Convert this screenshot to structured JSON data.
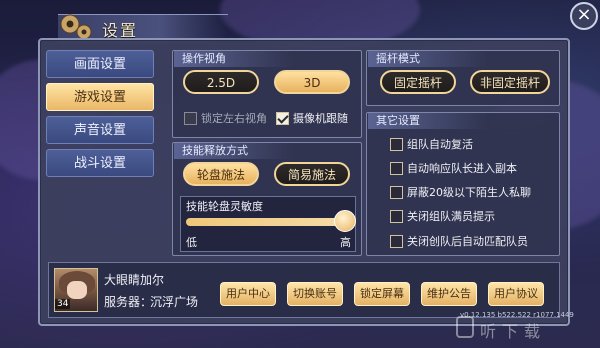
{
  "header": {
    "title": "设置",
    "close": "×"
  },
  "nav": {
    "items": [
      {
        "label": "画面设置",
        "active": false
      },
      {
        "label": "游戏设置",
        "active": true
      },
      {
        "label": "声音设置",
        "active": false
      },
      {
        "label": "战斗设置",
        "active": false
      }
    ]
  },
  "view": {
    "title": "操作视角",
    "options": [
      "2.5D",
      "3D"
    ],
    "selected": "3D",
    "lock_label": "锁定左右视角",
    "lock_checked": false,
    "follow_label": "摄像机跟随",
    "follow_checked": true
  },
  "joystick": {
    "title": "摇杆模式",
    "options": [
      "固定摇杆",
      "非固定摇杆"
    ],
    "selected": "固定摇杆"
  },
  "skill": {
    "title": "技能释放方式",
    "options": [
      "轮盘施法",
      "简易施法"
    ],
    "selected": "轮盘施法",
    "sensitivity_label": "技能轮盘灵敏度",
    "low_label": "低",
    "high_label": "高",
    "sensitivity": 0.95
  },
  "other": {
    "title": "其它设置",
    "items": [
      {
        "label": "组队自动复活",
        "checked": false
      },
      {
        "label": "自动响应队长进入副本",
        "checked": false
      },
      {
        "label": "屏蔽20级以下陌生人私聊",
        "checked": false
      },
      {
        "label": "关闭组队满员提示",
        "checked": false
      },
      {
        "label": "关闭创队后自动匹配队员",
        "checked": false
      }
    ]
  },
  "player": {
    "name": "大眼睛加尔",
    "level": "34",
    "server_label": "服务器：",
    "server_name": "沉浮广场"
  },
  "bottom_buttons": [
    "用户中心",
    "切换账号",
    "锁定屏幕",
    "维护公告",
    "用户协议"
  ],
  "version": "v0.12.135 b522.522 r1077.1449",
  "watermark": "听下载",
  "colors": {
    "accent": "#e9b867",
    "panel": "#3c405e",
    "nav": "#3a4a80"
  }
}
